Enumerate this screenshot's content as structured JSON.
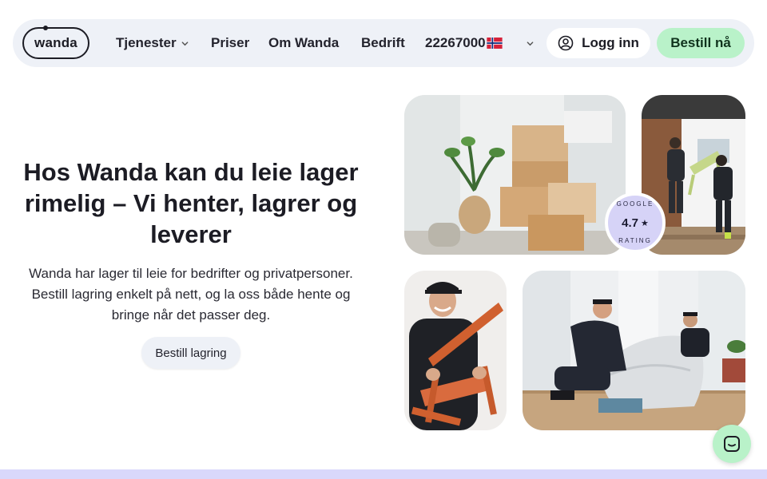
{
  "header": {
    "logo_text": "wanda",
    "nav": [
      {
        "label": "Tjenester",
        "has_dropdown": true
      },
      {
        "label": "Priser"
      },
      {
        "label": "Om Wanda"
      },
      {
        "label": "Bedrift"
      }
    ],
    "phone": "22267000",
    "language_flag": "norway-flag-icon",
    "login_label": "Logg inn",
    "order_label": "Bestill nå",
    "colors": {
      "nav_bg": "#eef1f7",
      "order_bg": "#b9f2c9"
    }
  },
  "hero": {
    "title": "Hos Wanda kan du leie lager rimelig – Vi henter, lagrer og leverer",
    "subtitle": "Wanda har lager til leie for bedrifter og privatpersoner. Bestill lagring enkelt på nett, og la oss både hente og bringe når det passer deg.",
    "cta_label": "Bestill lagring"
  },
  "rating": {
    "top_text": "GOOGLE",
    "value": "4.7",
    "star": "★",
    "bottom_text": "RATING",
    "badge_color": "#d6d3f7"
  },
  "images": [
    {
      "icon": "moving-boxes-photo"
    },
    {
      "icon": "movers-carrying-chair-photo"
    },
    {
      "icon": "mover-holding-chair-photo"
    },
    {
      "icon": "movers-wrapping-sofa-photo"
    }
  ],
  "chat": {
    "icon": "chat-icon"
  }
}
